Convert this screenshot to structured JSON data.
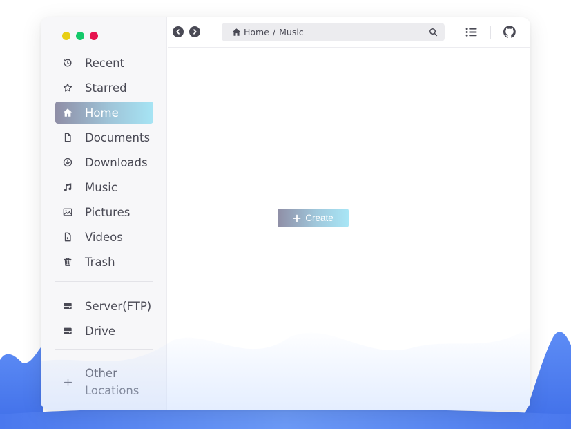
{
  "window": {
    "traffic_lights": [
      "yellow",
      "green",
      "red"
    ]
  },
  "sidebar": {
    "items": [
      {
        "label": "Recent",
        "icon": "history-icon"
      },
      {
        "label": "Starred",
        "icon": "star-icon"
      },
      {
        "label": "Home",
        "icon": "home-icon",
        "active": true
      },
      {
        "label": "Documents",
        "icon": "document-icon"
      },
      {
        "label": "Downloads",
        "icon": "download-icon"
      },
      {
        "label": "Music",
        "icon": "music-icon"
      },
      {
        "label": "Pictures",
        "icon": "image-icon"
      },
      {
        "label": "Videos",
        "icon": "video-file-icon"
      },
      {
        "label": "Trash",
        "icon": "trash-icon"
      }
    ],
    "devices": [
      {
        "label": "Server(FTP)",
        "icon": "server-icon"
      },
      {
        "label": "Drive",
        "icon": "drive-icon"
      }
    ],
    "other_locations": {
      "label": "Other Locations",
      "icon": "plus-icon"
    }
  },
  "toolbar": {
    "back_icon": "chevron-left-icon",
    "forward_icon": "chevron-right-icon",
    "path": {
      "root": "Home",
      "separator": "/",
      "current": "Music"
    },
    "search_icon": "search-icon",
    "view_icon": "list-view-icon",
    "github_icon": "github-icon"
  },
  "main": {
    "create_label": "Create"
  },
  "colors": {
    "accent_start": "#8f8ea6",
    "accent_end": "#a6e4f4",
    "text": "#4a4a55",
    "wave": "#4a7bf0"
  }
}
